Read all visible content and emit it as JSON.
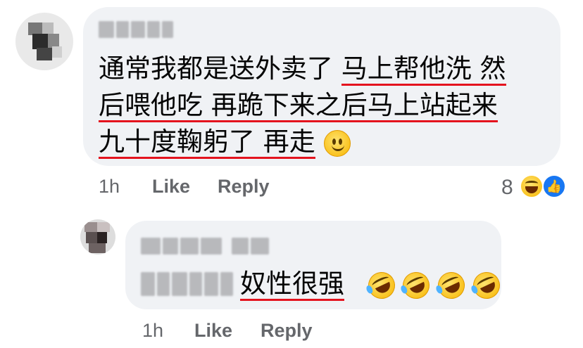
{
  "comments": [
    {
      "author_blurred": true,
      "lines": [
        {
          "plain": "通常我都是送外卖了 ",
          "underlined": "马上帮他洗 然"
        },
        {
          "plain": "",
          "underlined": "后喂他吃 再跪下来之后马上站起来"
        },
        {
          "plain": "",
          "underlined": "九十度鞠躬了 再走",
          "trail": " "
        }
      ],
      "emoji": "slightly-smiling-face-icon",
      "time": "1h",
      "like_label": "Like",
      "reply_label": "Reply",
      "reaction_count": "8",
      "reaction_icons": [
        "haha-reaction-icon",
        "like-reaction-icon"
      ]
    },
    {
      "author_blurred": true,
      "mention_blurred": true,
      "text": "奴性很强",
      "emojis": [
        "rofl-icon",
        "rofl-icon",
        "rofl-icon",
        "rofl-icon"
      ],
      "time": "1h",
      "like_label": "Like",
      "reply_label": "Reply"
    }
  ],
  "colors": {
    "bubble": "#f0f2f5",
    "underline": "#e4131e",
    "meta_text": "#65676b",
    "like_blue": "#1877f2"
  }
}
